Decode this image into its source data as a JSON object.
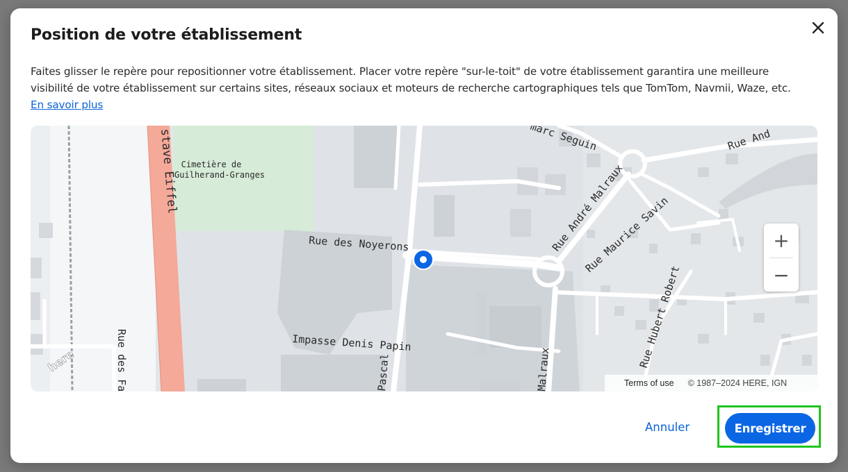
{
  "dialog": {
    "title": "Position de votre établissement",
    "description": "Faites glisser le repère pour repositionner votre établissement. Placer votre repère \"sur-le-toit\" de votre établissement garantira une meilleure visibilité de votre établissement sur certains sites, réseaux sociaux et moteurs de recherche cartographiques tels que TomTom, Navmii, Waze, etc.",
    "learn_more_link": "En savoir plus",
    "close_icon": "close-icon"
  },
  "map": {
    "labels": {
      "cemetery_line1": "Cimetière de",
      "cemetery_line2": "Guilherand-Granges",
      "rue_noyerons": "Rue des Noyerons",
      "impasse_papin": "Impasse Denis Papin",
      "gustave_eiffel": "stave Eiffel",
      "marc_seguin": "marc Seguin",
      "andre_malraux": "Rue André Malraux",
      "maurice_savin": "Rue Maurice Savin",
      "hubert_robert": "Rue Hubert Robert",
      "rue_and": "Rue And",
      "rue_des_fa": "Rue des Fa",
      "pascal": "Pascal",
      "malraux": "Malraux",
      "here_logo": "here"
    },
    "zoom_in": "+",
    "zoom_out": "−",
    "terms": "Terms of use",
    "copyright": "© 1987–2024 HERE, IGN",
    "marker_color": "#0b66e4"
  },
  "footer": {
    "cancel_label": "Annuler",
    "save_label": "Enregistrer",
    "highlight_color": "#1ec51e"
  }
}
